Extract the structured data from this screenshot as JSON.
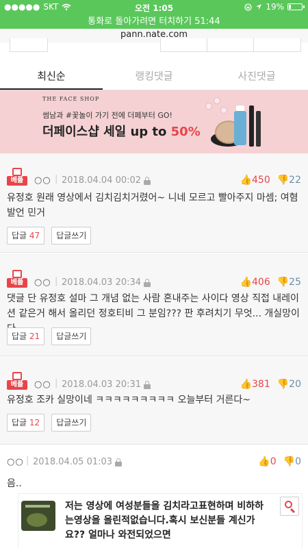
{
  "status_bar": {
    "carrier": "SKT",
    "time": "오전 1:05",
    "battery": "19%",
    "battery_fraction": 0.19
  },
  "call_bar": {
    "text": "통화로 돌아가려면 터치하기 51:44"
  },
  "url_bar": {
    "url": "pann.nate.com"
  },
  "tabs": [
    {
      "label": "최신순",
      "active": true
    },
    {
      "label": "랭킹댓글",
      "active": false
    },
    {
      "label": "사진댓글",
      "active": false
    }
  ],
  "banner": {
    "brand": "THE FACE SHOP",
    "subtitle": "썸남과 #꽃놀이 가기 전에 더페부터 GO!",
    "headline": "더페이스샵 세일 up to ",
    "headline_pct": "50%"
  },
  "best_label": "베플",
  "reply_label": "답글",
  "write_reply_label": "답글쓰기",
  "comments": [
    {
      "nick": "○○",
      "date": "2018.04.04 00:02",
      "up": "450",
      "down": "22",
      "text": "유정호 원래 영상에서 김치김치거렸어~ 니네 모르고 빨아주지 마셈; 여혐발언 민거",
      "replies": "47"
    },
    {
      "nick": "○○",
      "date": "2018.04.03 20:34",
      "up": "406",
      "down": "25",
      "text": "댓글 단 유정호 설마 그 개념 없는 사람 혼내주는 사이다 영상 직접 내레이션 같은거 해서 올리던 정호티비 그 분임??? 판 후려치기 무엇... 개실망이다",
      "replies": "21"
    },
    {
      "nick": "○○",
      "date": "2018.04.03 20:31",
      "up": "381",
      "down": "20",
      "text": "유정호 조카 실망이네 ㅋㅋㅋㅋㅋㅋㅋㅋㅋ 오늘부터 거른다~",
      "replies": "12"
    }
  ],
  "plain_comment": {
    "nick": "○○",
    "date": "2018.04.05 01:03",
    "up": "0",
    "down": "0",
    "text": "음..",
    "link_title": "저는 영상에 여성분들을 김치라고표현하며 비하하는영상을 올린적없습니다.혹시 보신분들 계신가요?? 얼마나 와전되었으면"
  },
  "icons": [
    "wifi-icon",
    "location-icon",
    "battery-icon",
    "best-thumb-icon",
    "lock-icon",
    "thumb-up-icon",
    "thumb-down-icon",
    "search-icon"
  ],
  "colors": {
    "call_green": "#5ac75b",
    "accent_red": "#e8454a",
    "down_blue": "#6b8fa8",
    "banner_pink": "#f5d1d3"
  }
}
